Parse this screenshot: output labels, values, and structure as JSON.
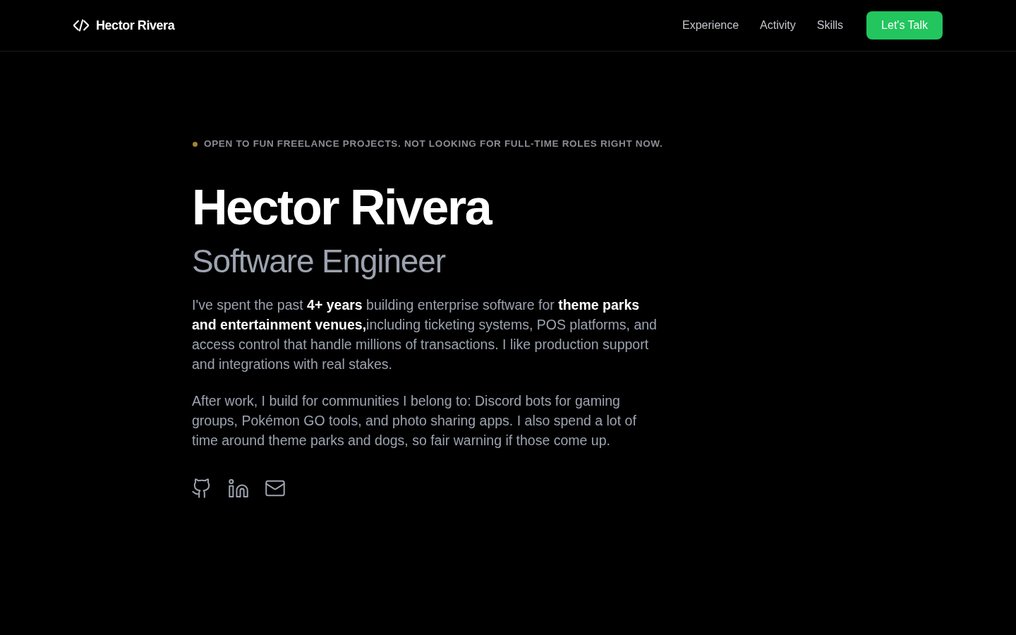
{
  "header": {
    "logo": {
      "text": "Hector Rivera"
    },
    "nav": [
      {
        "label": "Experience"
      },
      {
        "label": "Activity"
      },
      {
        "label": "Skills"
      }
    ],
    "cta": {
      "label": "Let's Talk"
    }
  },
  "hero": {
    "status": {
      "color": "#a3862a",
      "text": "OPEN TO FUN FREELANCE PROJECTS. NOT LOOKING FOR FULL-TIME ROLES RIGHT NOW."
    },
    "name": "Hector Rivera",
    "title": "Software Engineer",
    "paragraphs": [
      "I've spent the past **4+ years** building enterprise software for **theme parks and entertainment venues,**including ticketing systems, POS platforms, and access control that handle millions of transactions. I like production support and integrations with real stakes.",
      "After work, I build for communities I belong to: Discord bots for gaming groups, Pokémon GO tools, and photo sharing apps. I also spend a lot of time around theme parks and dogs, so fair warning if those come up."
    ],
    "social_links": [
      {
        "kind": "github"
      },
      {
        "kind": "linkedin"
      },
      {
        "kind": "email"
      }
    ]
  }
}
